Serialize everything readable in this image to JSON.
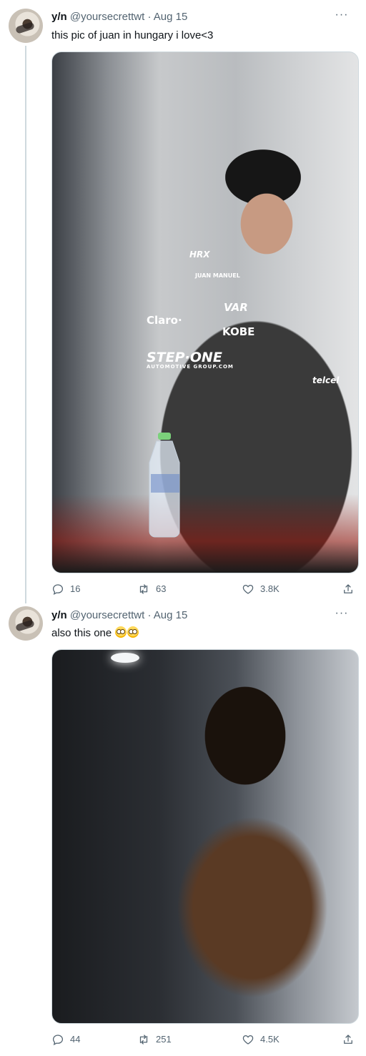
{
  "tweets": [
    {
      "name": "y/n",
      "handle": "@yoursecrettwt",
      "separator": "·",
      "time": "Aug 15",
      "text": "this pic of juan in hungary i love<3",
      "media_labels": {
        "hrx": "HRX",
        "juan_manuel": "JUAN MANUEL",
        "claro": "Claro·",
        "var": "VAR",
        "kobe": "KOBE",
        "step_one": "STEP·ONE",
        "automotive": "AUTOMOTIVE GROUP.COM",
        "telcel": "telcel"
      },
      "stats": {
        "replies": "16",
        "retweets": "63",
        "likes": "3.8K"
      }
    },
    {
      "name": "y/n",
      "handle": "@yoursecrettwt",
      "separator": "·",
      "time": "Aug 15",
      "text": "also this one",
      "emoji": [
        "flushed-face-emoji",
        "flushed-face-emoji"
      ],
      "stats": {
        "replies": "44",
        "retweets": "251",
        "likes": "4.5K"
      }
    }
  ],
  "more_menu_label": "···",
  "colors": {
    "text": "#0f1419",
    "secondary": "#536471",
    "border": "#cfd9de"
  }
}
